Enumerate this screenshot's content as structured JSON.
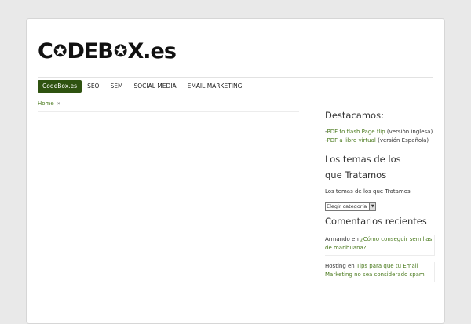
{
  "brand": {
    "logo_a": "C",
    "logo_b": "DEB",
    "logo_c": "X.es"
  },
  "nav": [
    "CodeBox.es",
    "SEO",
    "SEM",
    "SOCIAL MEDIA",
    "EMAIL MARKETING"
  ],
  "breadcrumb": {
    "home": "Home",
    "sep": "»"
  },
  "sidebar": {
    "featured_title": "Destacamos:",
    "featured": [
      {
        "link": "PDF to flash Page flip",
        "rest": " (versión inglesa)"
      },
      {
        "link": "PDF a libro virtual",
        "rest": " (versión Española)"
      }
    ],
    "topics_title": "Los temas de los que Tratamos",
    "topics_label": "Los temas de los que Tratamos",
    "select_value": "Elegir categoría",
    "comments_title": "Comentarios recientes",
    "comments": [
      {
        "author": "Armando",
        "on": " en ",
        "post": "¿Cómo conseguir semillas de marihuana?"
      },
      {
        "author": "Hosting",
        "on": " en ",
        "post": "Tips para que tu Email Marketing no sea considerado spam"
      }
    ]
  },
  "colors": {
    "accent": "#2f5310",
    "link": "#4a7a1d",
    "background": "#e9e9e9"
  }
}
